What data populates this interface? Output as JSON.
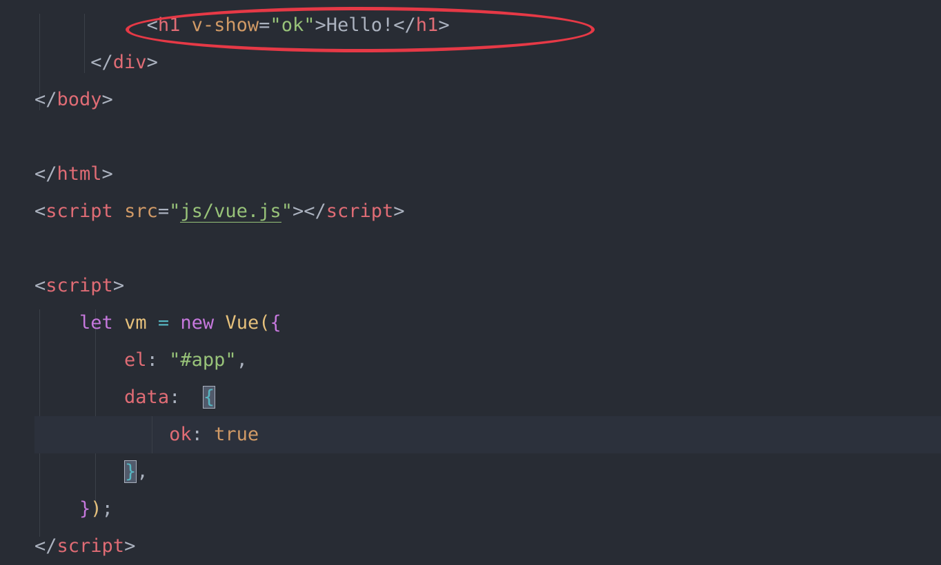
{
  "annotation": {
    "type": "ellipse",
    "color": "#e63946"
  },
  "code": {
    "line1_indent": "          ",
    "line1_bracket_open": "<",
    "line1_tag_h1": "h1",
    "line1_space": " ",
    "line1_attr_vshow": "v-show",
    "line1_equals": "=",
    "line1_quote1": "\"",
    "line1_attr_val_ok": "ok",
    "line1_quote2": "\"",
    "line1_bracket_close": ">",
    "line1_text_hello": "Hello!",
    "line1_close_open": "</",
    "line1_close_tag": "h1",
    "line1_close_bracket": ">",
    "line2_indent": "     ",
    "line2_close_open": "</",
    "line2_tag_div": "div",
    "line2_close_bracket": ">",
    "line3_close_open": "</",
    "line3_tag_body": "body",
    "line3_close_bracket": ">",
    "line4_empty": "",
    "line5_close_open": "</",
    "line5_tag_html": "html",
    "line5_close_bracket": ">",
    "line6_open": "<",
    "line6_tag_script": "script",
    "line6_space": " ",
    "line6_attr_src": "src",
    "line6_equals": "=",
    "line6_quote1": "\"",
    "line6_attr_val_js": "js/vue.js",
    "line6_quote2": "\"",
    "line6_close": ">",
    "line6_close_open": "</",
    "line6_close_tag": "script",
    "line6_close_bracket": ">",
    "line7_empty": "",
    "line8_open": "<",
    "line8_tag_script": "script",
    "line8_close": ">",
    "line9_indent": "    ",
    "line9_keyword_let": "let",
    "line9_space1": " ",
    "line9_var_vm": "vm",
    "line9_space2": " ",
    "line9_equals": "=",
    "line9_space3": " ",
    "line9_keyword_new": "new",
    "line9_space4": " ",
    "line9_class_vue": "Vue",
    "line9_paren_open": "(",
    "line9_brace_open": "{",
    "line10_indent": "        ",
    "line10_prop_el": "el",
    "line10_colon": ":",
    "line10_space": " ",
    "line10_quote1": "\"",
    "line10_val_app": "#app",
    "line10_quote2": "\"",
    "line10_comma": ",",
    "line11_indent": "        ",
    "line11_prop_data": "data",
    "line11_colon": ":",
    "line11_space": "  ",
    "line11_brace_open": "{",
    "line12_indent": "            ",
    "line12_prop_ok": "ok",
    "line12_colon": ":",
    "line12_space": " ",
    "line12_val_true": "true",
    "line13_indent": "        ",
    "line13_brace_close": "}",
    "line13_comma": ",",
    "line14_indent": "    ",
    "line14_brace_close": "}",
    "line14_paren_close": ")",
    "line14_semi": ";",
    "line15_close_open": "</",
    "line15_tag_script": "script",
    "line15_close_bracket": ">"
  }
}
